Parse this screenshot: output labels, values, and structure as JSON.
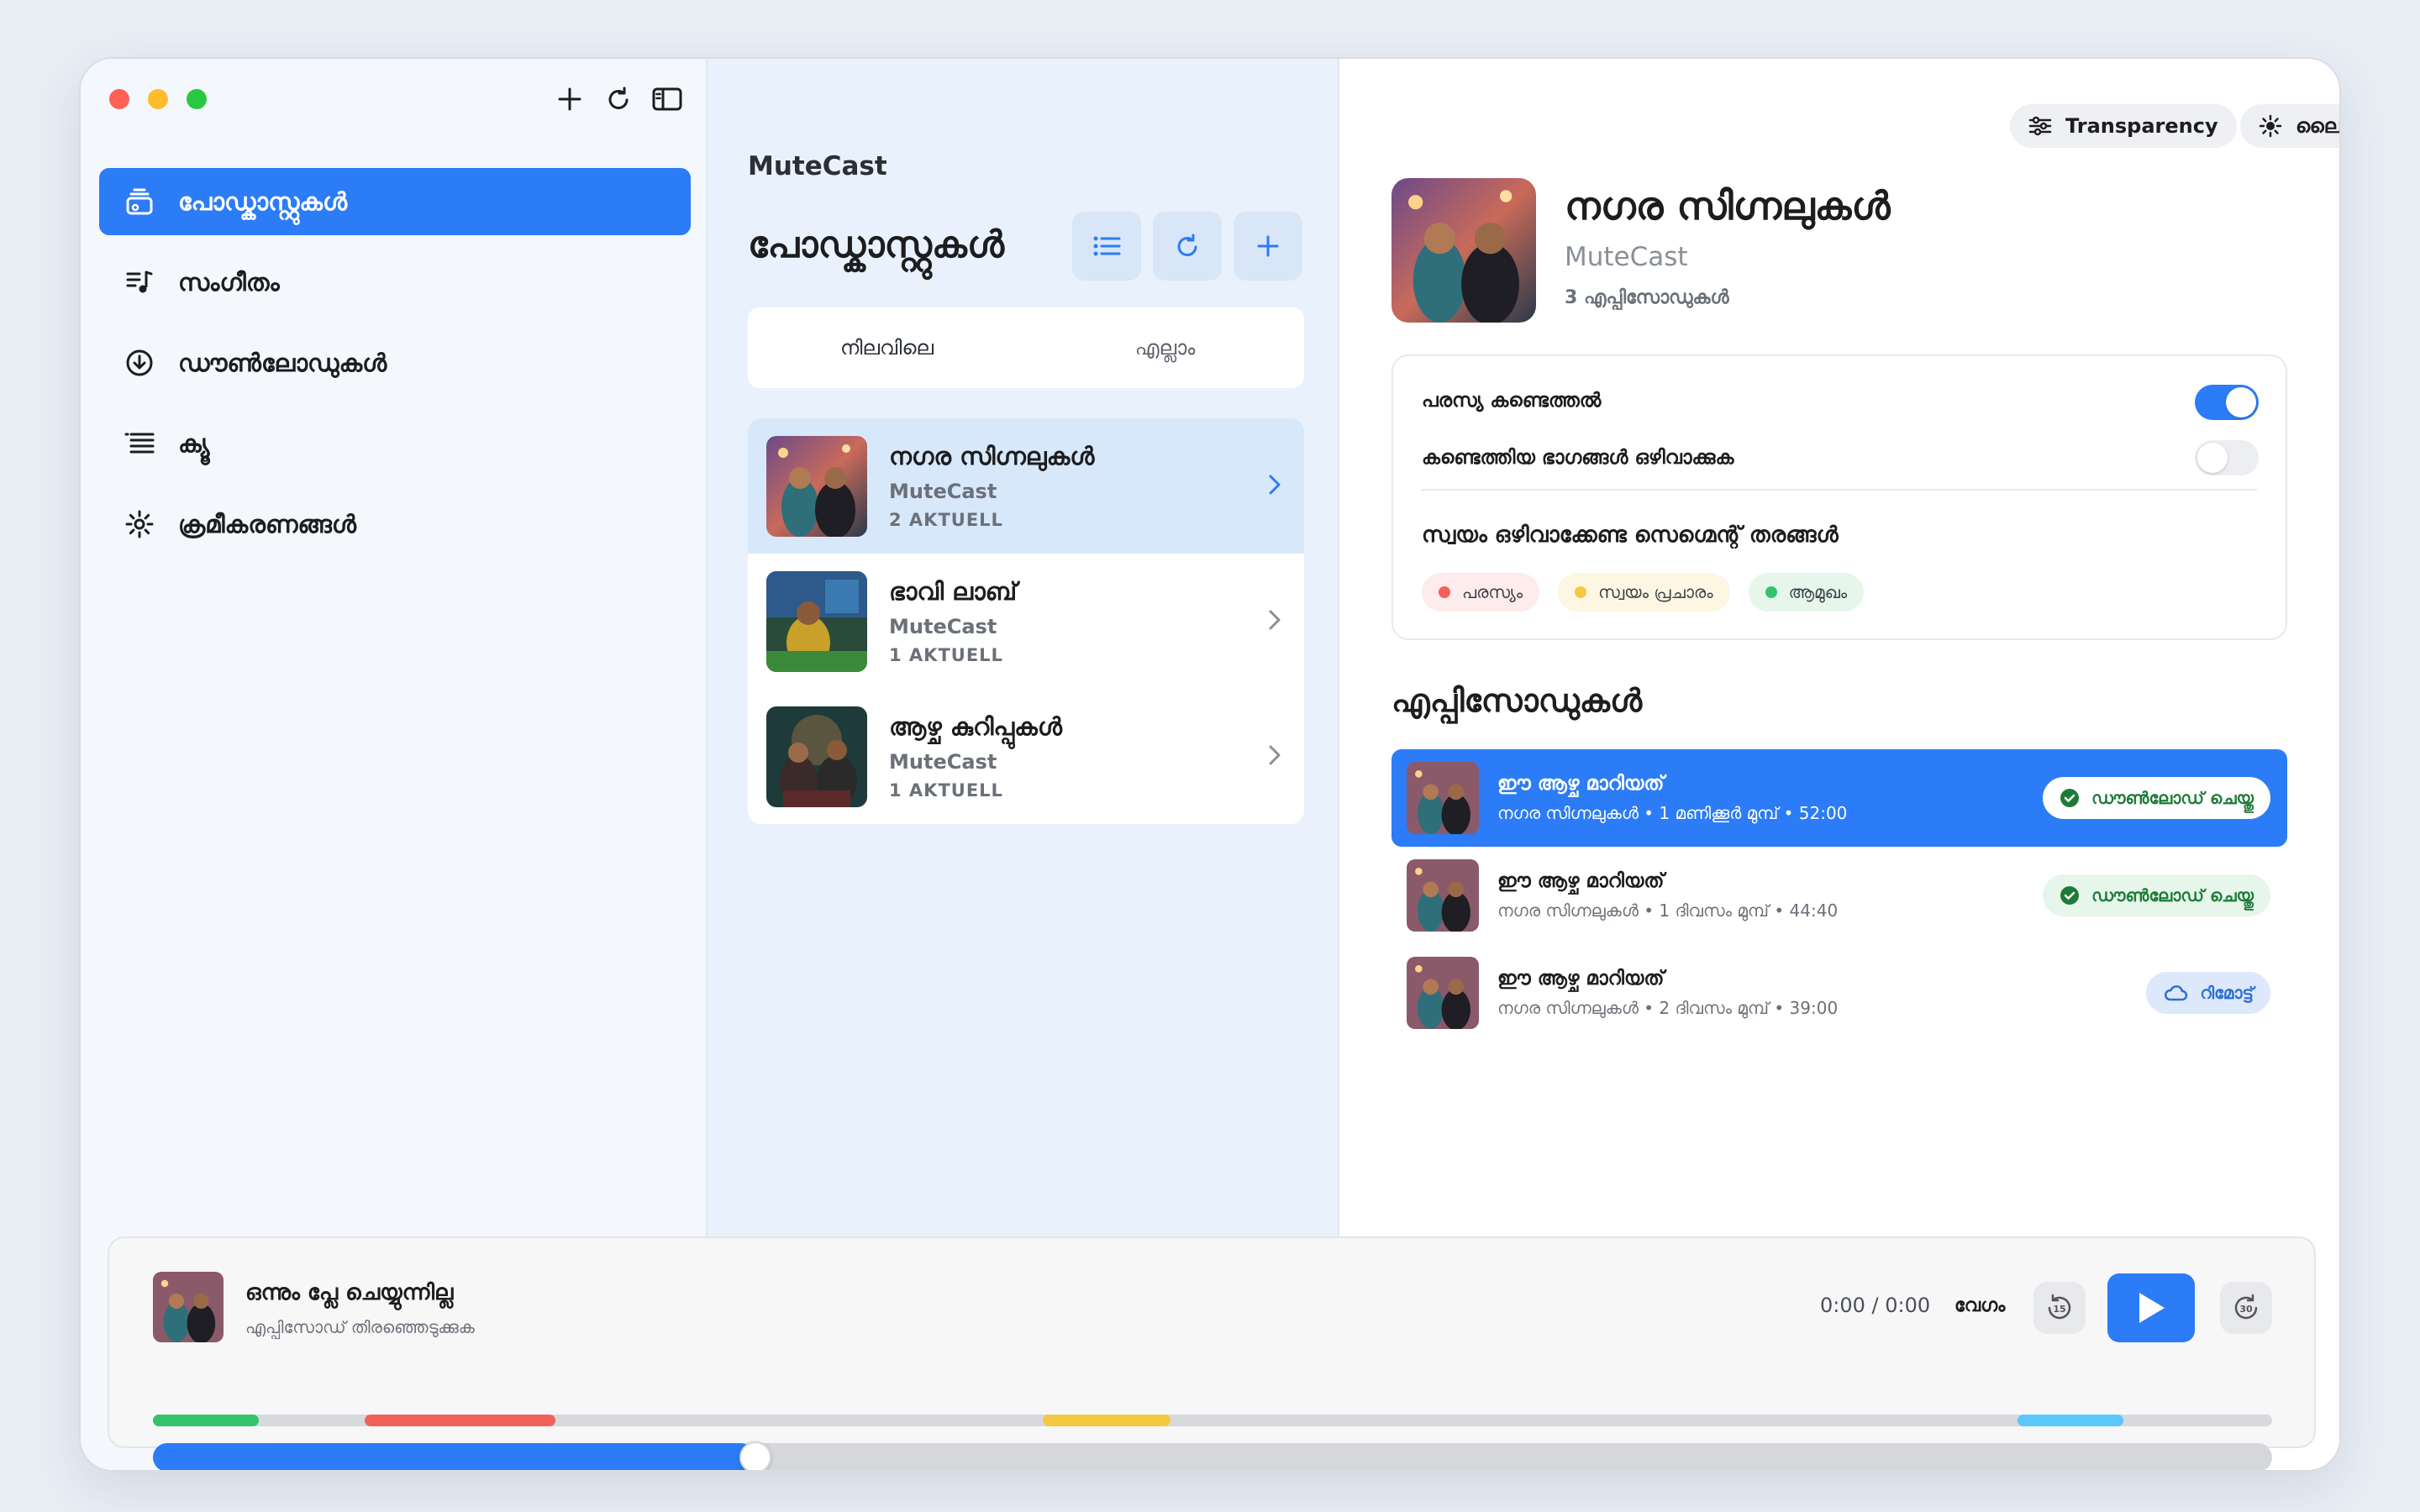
{
  "sidebar": {
    "items": [
      {
        "label": "പോഡ്കാസ്റ്റുകൾ",
        "icon": "podcast-stack-icon",
        "active": true
      },
      {
        "label": "സംഗീതം",
        "icon": "music-list-icon",
        "active": false
      },
      {
        "label": "ഡൗൺലോഡുകൾ",
        "icon": "download-circle-icon",
        "active": false
      },
      {
        "label": "ക്യൂ",
        "icon": "queue-list-icon",
        "active": false
      },
      {
        "label": "ക്രമീകരണങ്ങൾ",
        "icon": "gear-icon",
        "active": false
      }
    ]
  },
  "middle": {
    "app_name": "MuteCast",
    "title": "പോഡ്കാസ്റ്റുകൾ",
    "segments": [
      "നിലവിലെ",
      "എല്ലാം"
    ],
    "podcasts": [
      {
        "name": "നഗര സിഗ്നലുകൾ",
        "author": "MuteCast",
        "count": "2 AKTUELL",
        "selected": true
      },
      {
        "name": "ഭാവി ലാബ്",
        "author": "MuteCast",
        "count": "1 AKTUELL",
        "selected": false
      },
      {
        "name": "ആഴ്ച കുറിപ്പുകൾ",
        "author": "MuteCast",
        "count": "1 AKTUELL",
        "selected": false
      }
    ]
  },
  "detail": {
    "transparency_label": "Transparency",
    "theme_label": "ലൈറ്റ്",
    "podcast_title": "നഗര സിഗ്നലുകൾ",
    "podcast_author": "MuteCast",
    "episode_count": "3 എപ്പിസോഡുകൾ",
    "settings": {
      "ad_detection_label": "പരസ്യ കണ്ടെത്തൽ",
      "ad_detection_on": true,
      "skip_detected_label": "കണ്ടെത്തിയ ഭാഗങ്ങൾ ഒഴിവാക്കുക",
      "skip_detected_on": false,
      "segment_types_title": "സ്വയം ഒഴിവാക്കേണ്ട സെഗ്മെന്റ് തരങ്ങൾ",
      "tags": [
        {
          "label": "പരസ്യം",
          "color": "#f0625a",
          "bg": "#fdeceb"
        },
        {
          "label": "സ്വയം പ്രചാരം",
          "color": "#f5c842",
          "bg": "#fdf6e3"
        },
        {
          "label": "ആമുഖം",
          "color": "#34c36b",
          "bg": "#e6f6ea"
        }
      ]
    },
    "episodes_heading": "എപ്പിസോഡുകൾ",
    "episodes": [
      {
        "title": "ഈ ആഴ്ച മാറിയത്",
        "meta": "നഗര സിഗ്നലുകൾ • 1 മണിക്കൂർ മുമ്പ് • 52:00",
        "badge": "ഡൗൺലോഡ് ചെയ്തു",
        "status": "downloaded",
        "active": true
      },
      {
        "title": "ഈ ആഴ്ച മാറിയത്",
        "meta": "നഗര സിഗ്നലുകൾ • 1 ദിവസം മുമ്പ് • 44:40",
        "badge": "ഡൗൺലോഡ് ചെയ്തു",
        "status": "downloaded",
        "active": false
      },
      {
        "title": "ഈ ആഴ്ച മാറിയത്",
        "meta": "നഗര സിഗ്നലുകൾ • 2 ദിവസം മുമ്പ് • 39:00",
        "badge": "റിമോട്ട്",
        "status": "remote",
        "active": false
      }
    ]
  },
  "player": {
    "title": "ഒന്നും പ്ലേ ചെയ്യുന്നില്ല",
    "subtitle": "എപ്പിസോഡ് തിരഞ്ഞെടുക്കുക",
    "time": "0:00 / 0:00",
    "speed_label": "വേഗം",
    "skip_back_seconds": "15",
    "skip_forward_seconds": "30",
    "progress_fraction": 0.28,
    "segments": [
      {
        "start": 0.0,
        "end": 0.05,
        "color": "#34c36b"
      },
      {
        "start": 0.1,
        "end": 0.19,
        "color": "#f0625a"
      },
      {
        "start": 0.42,
        "end": 0.48,
        "color": "#f5c842"
      },
      {
        "start": 0.88,
        "end": 0.93,
        "color": "#5ac8fa"
      }
    ]
  },
  "colors": {
    "accent": "#2b7cf6"
  }
}
